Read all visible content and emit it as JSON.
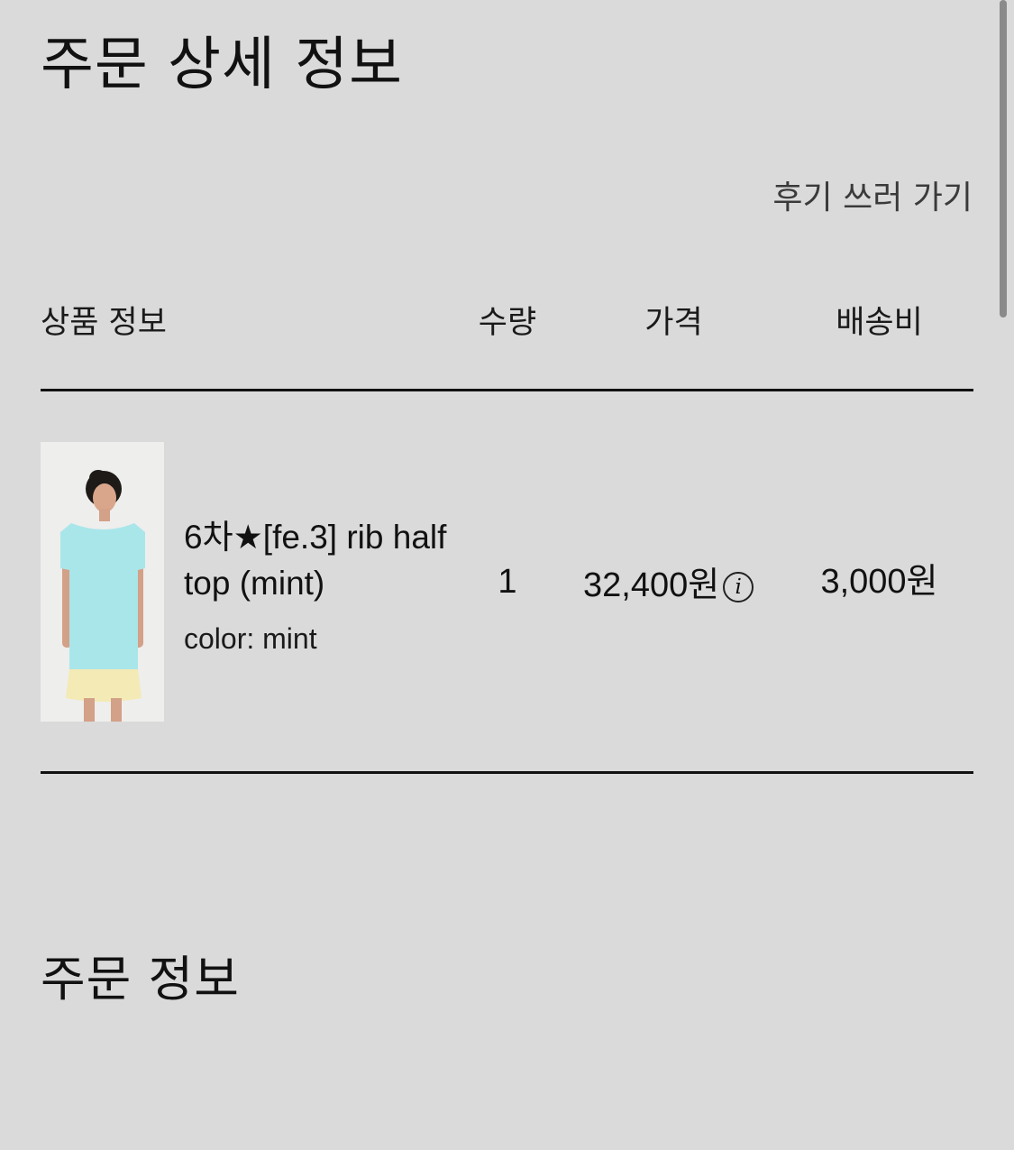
{
  "header": {
    "title": "주문 상세 정보",
    "review_link": "후기 쓰러 가기"
  },
  "table": {
    "columns": {
      "product": "상품 정보",
      "quantity": "수량",
      "price": "가격",
      "shipping": "배송비"
    },
    "rows": [
      {
        "name": "6차★[fe.3] rib half top (mint)",
        "option": "color: mint",
        "quantity": "1",
        "price": "32,400원",
        "shipping": "3,000원",
        "price_info_icon": "info-icon",
        "thumbnail_colors": {
          "top": "#a9e6ea",
          "skirt": "#f3eab5"
        }
      }
    ]
  },
  "order_info": {
    "title": "주문 정보"
  },
  "colors": {
    "background": "#dadada",
    "text": "#111111",
    "divider": "#111111"
  }
}
